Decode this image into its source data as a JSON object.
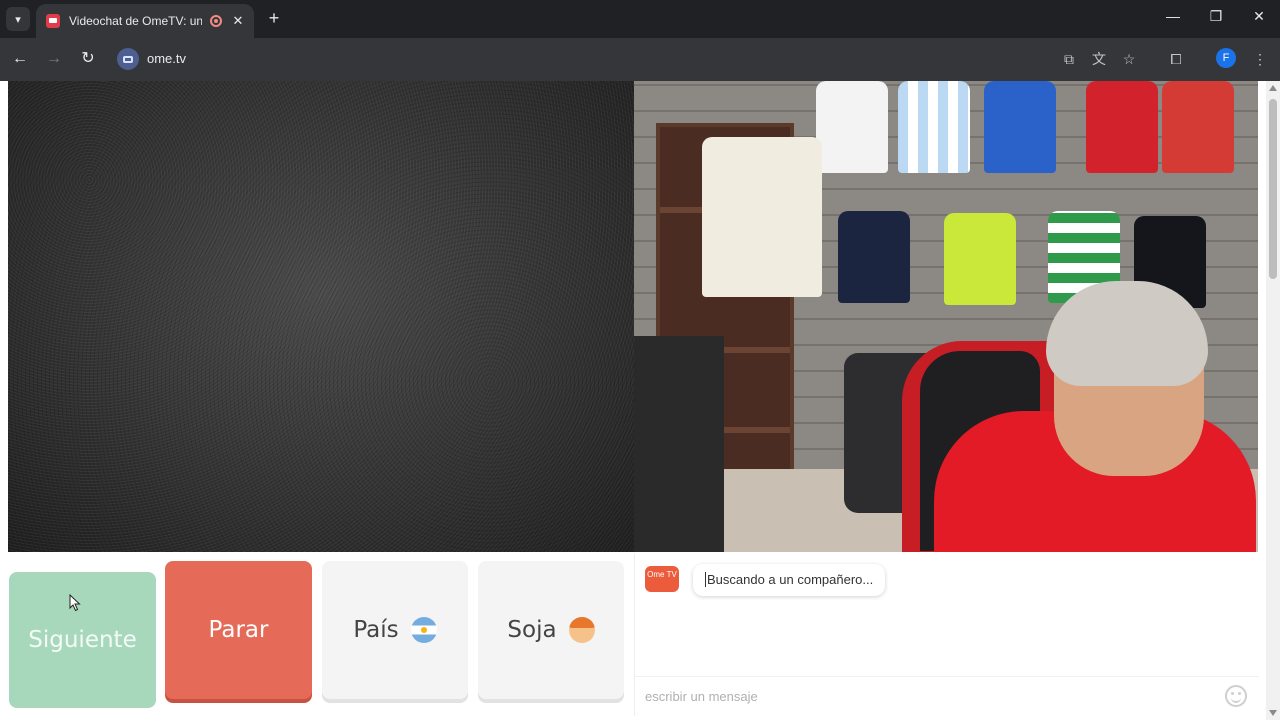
{
  "browser": {
    "tab": {
      "title": "Videochat de OmeTV: una",
      "favicon": "ometv-favicon-icon",
      "recording_indicator": "recording-icon",
      "close": "✕"
    },
    "new_tab": "+",
    "window_controls": {
      "minimize": "—",
      "restore": "❐",
      "close": "✕"
    },
    "url": "ome.tv",
    "profile_initial": "F"
  },
  "buttons": {
    "next": "Siguiente",
    "stop": "Parar",
    "country": "País",
    "gender": "Soja"
  },
  "chat": {
    "logo_text": "Ome TV",
    "status_message": "Buscando a un compañero...",
    "input_placeholder": "escribir un mensaje"
  },
  "colors": {
    "next_button": "#a7d8bc",
    "stop_button": "#e56b58",
    "neutral_button": "#f4f4f4",
    "ometv_brand": "#ec5b3c"
  }
}
